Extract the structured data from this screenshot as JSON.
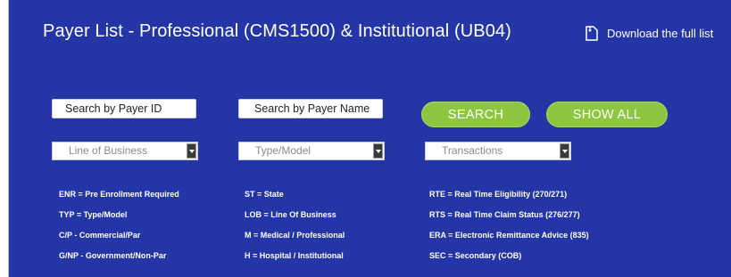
{
  "header": {
    "title": "Payer List - Professional (CMS1500) & Institutional (UB04)",
    "download_label": "Download the full list"
  },
  "search": {
    "payer_id_placeholder": "Search by Payer ID",
    "payer_name_placeholder": "Search by Payer Name",
    "search_label": "SEARCH",
    "show_all_label": "SHOW ALL"
  },
  "filters": {
    "line_of_business": "Line of Business",
    "type_model": "Type/Model",
    "transactions": "Transactions"
  },
  "legend": {
    "col1": [
      "ENR = Pre Enrollment Required",
      "TYP = Type/Model",
      "C/P - Commercial/Par",
      "G/NP - Government/Non-Par"
    ],
    "col2": [
      "ST = State",
      "LOB = Line Of Business",
      "M = Medical / Professional",
      "H = Hospital / Institutional"
    ],
    "col3": [
      "RTE = Real Time Eligibility (270/271)",
      "RTS = Real Time Claim Status (276/277)",
      "ERA = Electronic Remittance Advice (835)",
      "SEC = Secondary (COB)"
    ]
  },
  "colors": {
    "panel_background": "#2436a6",
    "button_green": "#8dc63f",
    "text": "#ffffff"
  },
  "icons": {
    "download": "document-download-icon",
    "dropdown": "chevron-down-icon"
  }
}
